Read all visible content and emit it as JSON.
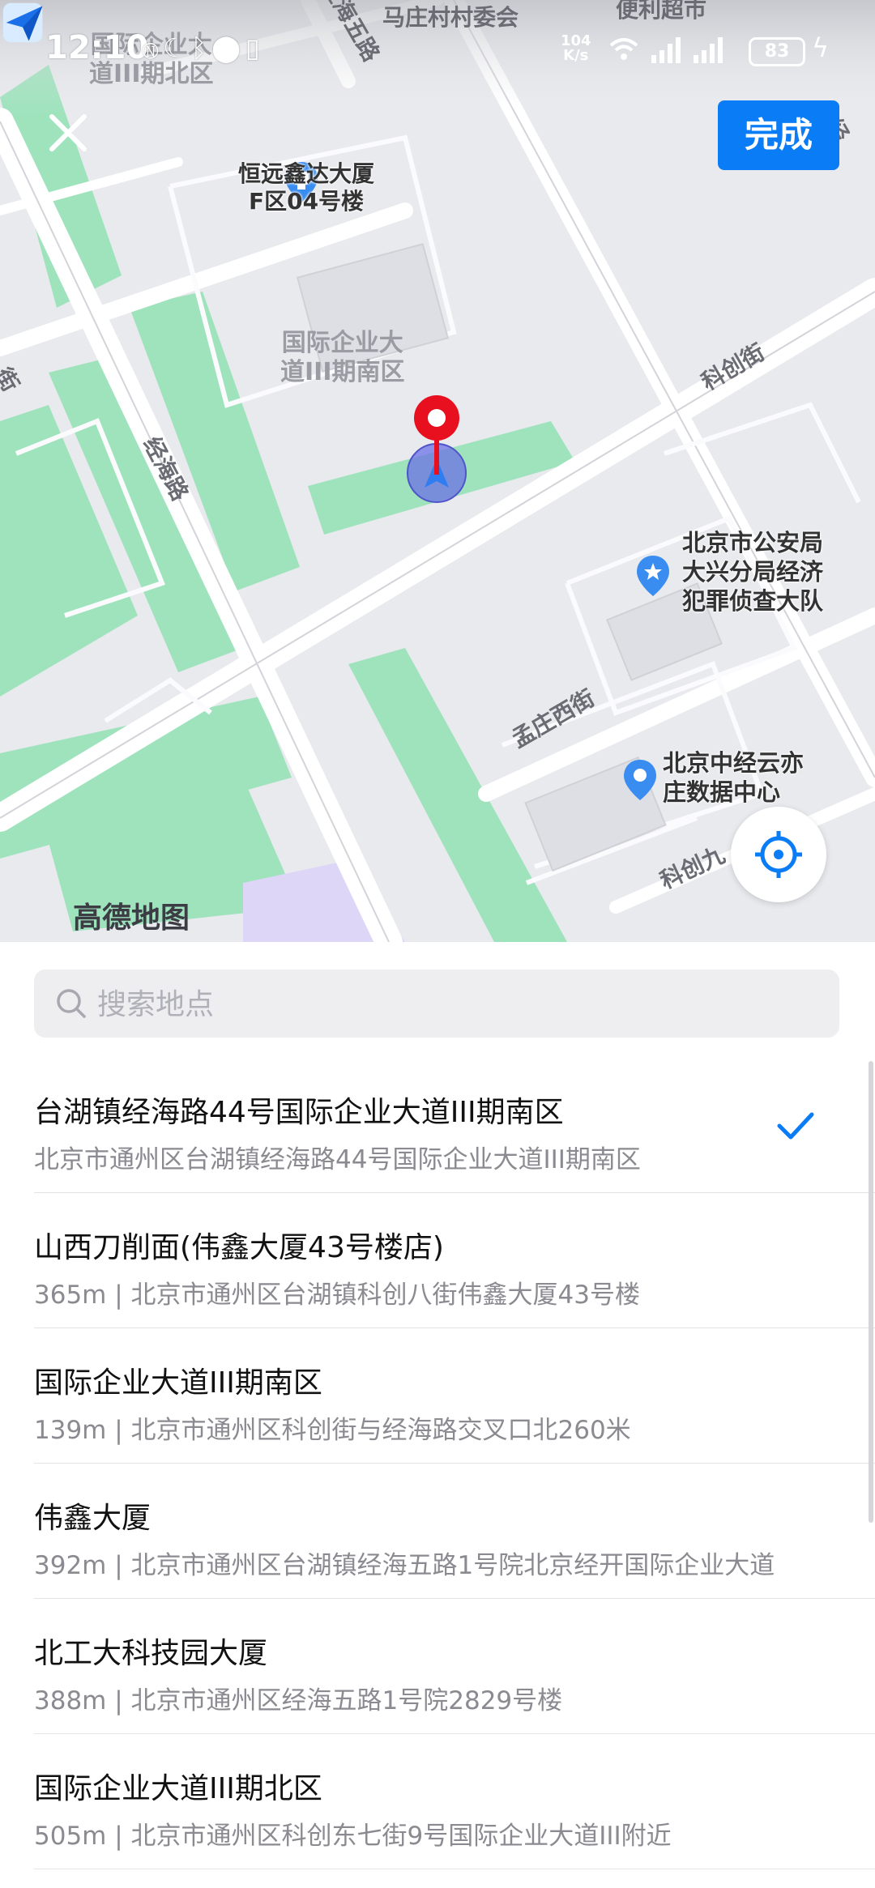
{
  "status_bar": {
    "time": "12:10",
    "net_speed_value": "104",
    "net_speed_unit": "K/s",
    "battery": "83"
  },
  "header": {
    "done_label": "完成"
  },
  "map": {
    "pois": [
      {
        "name": "恒远鑫达大厦\nF区04号楼"
      },
      {
        "name": "北京市公安局\n大兴分局经济\n犯罪侦查大队"
      },
      {
        "name": "北京中经云亦\n庄数据中心"
      }
    ],
    "areas": [
      "国际企业大\n道III期南区",
      "国际企业大\n道III期北区"
    ],
    "roads": [
      "马庄村村委会",
      "便利超市",
      "经海五路",
      "经海路",
      "科创街",
      "孟庄西街",
      "科创九",
      "街",
      "经"
    ],
    "logo_text": "高德地图"
  },
  "search": {
    "placeholder": "搜索地点"
  },
  "results": [
    {
      "title": "台湖镇经海路44号国际企业大道III期南区",
      "subtitle": "北京市通州区台湖镇经海路44号国际企业大道III期南区",
      "selected": true
    },
    {
      "title": "山西刀削面(伟鑫大厦43号楼店)",
      "subtitle": "365m | 北京市通州区台湖镇科创八街伟鑫大厦43号楼",
      "selected": false
    },
    {
      "title": "国际企业大道III期南区",
      "subtitle": "139m | 北京市通州区科创街与经海路交叉口北260米",
      "selected": false
    },
    {
      "title": "伟鑫大厦",
      "subtitle": "392m | 北京市通州区台湖镇经海五路1号院北京经开国际企业大道",
      "selected": false
    },
    {
      "title": "北工大科技园大厦",
      "subtitle": "388m | 北京市通州区经海五路1号院2829号楼",
      "selected": false
    },
    {
      "title": "国际企业大道III期北区",
      "subtitle": "505m | 北京市通州区科创东七街9号国际企业大道III附近",
      "selected": false
    }
  ],
  "colors": {
    "accent": "#0a7cf5",
    "green_area": "#93e0b3",
    "pin_red": "#e8101f"
  }
}
